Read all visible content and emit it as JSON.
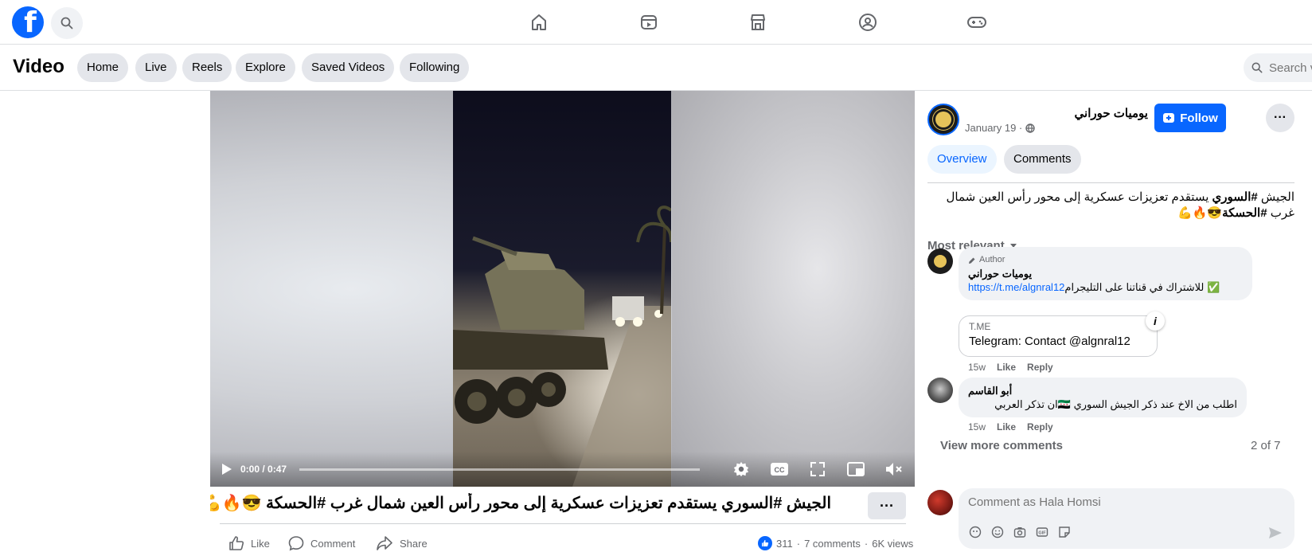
{
  "topbar": {
    "logo_letter": "f",
    "nav": [
      "home-icon",
      "video-icon",
      "marketplace-icon",
      "groups-icon",
      "gaming-icon"
    ]
  },
  "subheader": {
    "title": "Video",
    "tabs": [
      "Home",
      "Live",
      "Reels",
      "Explore",
      "Saved Videos",
      "Following"
    ],
    "search_placeholder": "Search videos"
  },
  "player": {
    "time": "0:00 / 0:47",
    "progress": 0.0
  },
  "post": {
    "caption": "الجيش #السوري يستقدم تعزيزات عسكرية إلى محور رأس العين شمال غرب #الحسكة 😎🔥💪",
    "more_label": "···",
    "actions": {
      "like": "Like",
      "comment": "Comment",
      "share": "Share"
    },
    "reactions_count": "311",
    "comments_count": "7 comments",
    "views": "6K views"
  },
  "panel": {
    "page_name": "يوميات حوراني",
    "date": "January 19 ·",
    "follow_label": "Follow",
    "more_label": "···",
    "tabs": {
      "overview": "Overview",
      "comments": "Comments"
    },
    "post_text_plain1": "الجيش ",
    "post_text_tag1": "#السوري",
    "post_text_plain2": " يستقدم تعزيزات عسكرية إلى محور رأس العين شمال غرب ",
    "post_text_tag2": "#الحسكة",
    "post_text_emoji": "😎🔥💪",
    "sort_label": "Most relevant",
    "comments": [
      {
        "author_tag": "Author",
        "name": "يوميات حوراني",
        "text_before": "للاشتراك في قناتنا على التليجرام ",
        "link": "https://t.me/algnral12",
        "text_after": "✅",
        "card_source": "T.ME",
        "card_title": "Telegram: Contact @algnral12",
        "time": "15w",
        "like": "Like",
        "reply": "Reply"
      },
      {
        "name": "أبو القاسم",
        "text": "اطلب من الاخ عند ذكر الجيش السوري 🇸🇾ان تذكر العربي",
        "time": "15w",
        "like": "Like",
        "reply": "Reply"
      }
    ],
    "view_more": "View more comments",
    "page_count": "2 of 7",
    "composer_placeholder": "Comment as Hala Homsi"
  },
  "colors": {
    "brand": "#0866ff",
    "muted": "#65676b",
    "surface": "#f0f2f5"
  }
}
